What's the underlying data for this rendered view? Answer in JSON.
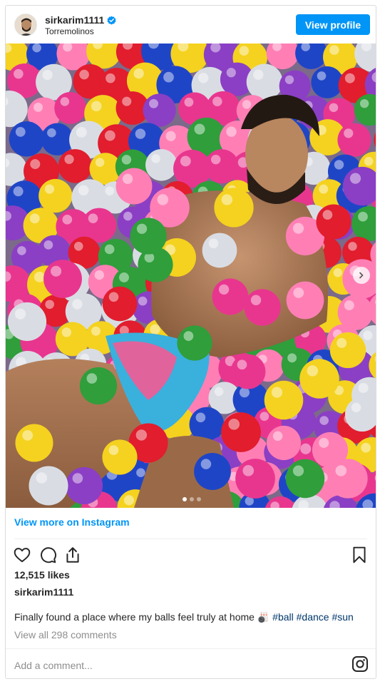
{
  "post": {
    "username": "sirkarim1111",
    "location": "Torremolinos",
    "view_profile_label": "View profile",
    "view_more_label": "View more on Instagram",
    "likes": "12,515 likes",
    "caption_user": "sirkarim1111",
    "caption_text": "Finally found a place where my balls feel truly at home 🎳 ",
    "hashtags": [
      "#ball",
      "#dance",
      "#sun"
    ],
    "view_comments": "View all 298 comments",
    "add_comment_placeholder": "Add a comment...",
    "carousel": {
      "total": 3,
      "active": 1
    }
  },
  "icons": {
    "verified": "verified-badge-icon",
    "like": "heart-icon",
    "comment": "comment-bubble-icon",
    "share": "share-icon",
    "save": "bookmark-icon",
    "next": "chevron-right-icon",
    "instagram": "instagram-logo-icon"
  },
  "colors": {
    "accent": "#0095f6",
    "text": "#262626",
    "muted": "#8e8e8e",
    "hashtag": "#00376b",
    "border": "#dbdbdb"
  }
}
